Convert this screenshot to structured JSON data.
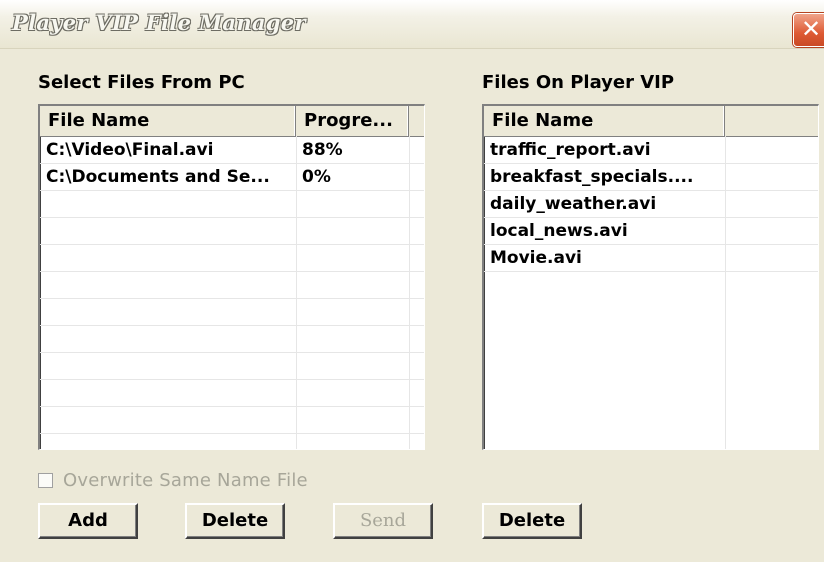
{
  "window": {
    "title": "Player VIP File Manager",
    "close_glyph": "✕"
  },
  "left_panel": {
    "label": "Select Files From PC",
    "columns": [
      "File Name",
      "Progre...",
      ""
    ],
    "rows": [
      {
        "name": "C:\\Video\\Final.avi",
        "progress": "88%"
      },
      {
        "name": "C:\\Documents and Se...",
        "progress": "0%"
      }
    ]
  },
  "right_panel": {
    "label": "Files On Player VIP",
    "columns": [
      "File Name",
      ""
    ],
    "rows": [
      {
        "name": "traffic_report.avi"
      },
      {
        "name": "breakfast_specials...."
      },
      {
        "name": "daily_weather.avi"
      },
      {
        "name": "local_news.avi"
      },
      {
        "name": "Movie.avi"
      }
    ]
  },
  "options": {
    "overwrite_label": "Overwrite Same Name File",
    "overwrite_checked": false
  },
  "buttons": {
    "add": "Add",
    "delete_left": "Delete",
    "send": "Send",
    "delete_right": "Delete"
  }
}
